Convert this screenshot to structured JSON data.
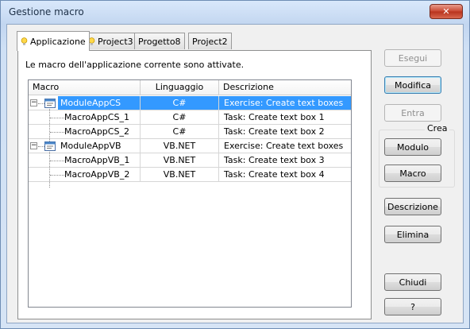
{
  "window": {
    "title": "Gestione macro",
    "close_glyph": "✕"
  },
  "tabs": [
    {
      "label": "Applicazione",
      "icon": "lightbulb-icon",
      "active": true
    },
    {
      "label": "Project3",
      "icon": "lightbulb-icon",
      "active": false
    },
    {
      "label": "Progetto8",
      "active": false
    },
    {
      "label": "Project2",
      "active": false
    }
  ],
  "info_text": "Le macro dell'applicazione corrente sono attivate.",
  "table": {
    "headers": [
      "Macro",
      "Linguaggio",
      "Descrizione"
    ],
    "rows": [
      {
        "macro": "ModuleAppCS",
        "lang": "C#",
        "desc": "Exercise: Create text boxes",
        "level": 0,
        "selected": true,
        "toggle": "−"
      },
      {
        "macro": "MacroAppCS_1",
        "lang": "C#",
        "desc": "Task: Create text box 1",
        "level": 1
      },
      {
        "macro": "MacroAppCS_2",
        "lang": "C#",
        "desc": "Task: Create text box 2",
        "level": 1
      },
      {
        "macro": "ModuleAppVB",
        "lang": "VB.NET",
        "desc": "Exercise: Create text boxes",
        "level": 0,
        "toggle": "−"
      },
      {
        "macro": "MacroAppVB_1",
        "lang": "VB.NET",
        "desc": "Task: Create text box 3",
        "level": 1
      },
      {
        "macro": "MacroAppVB_2",
        "lang": "VB.NET",
        "desc": "Task: Create text box 4",
        "level": 1
      }
    ]
  },
  "buttons": {
    "esegui": "Esegui",
    "modifica": "Modifica",
    "entra": "Entra",
    "crea_label": "Crea",
    "modulo": "Modulo",
    "macro": "Macro",
    "descrizione": "Descrizione",
    "elimina": "Elimina",
    "chiudi": "Chiudi",
    "help": "?"
  },
  "colors": {
    "selection": "#3399ff",
    "close": "#c8452f"
  }
}
